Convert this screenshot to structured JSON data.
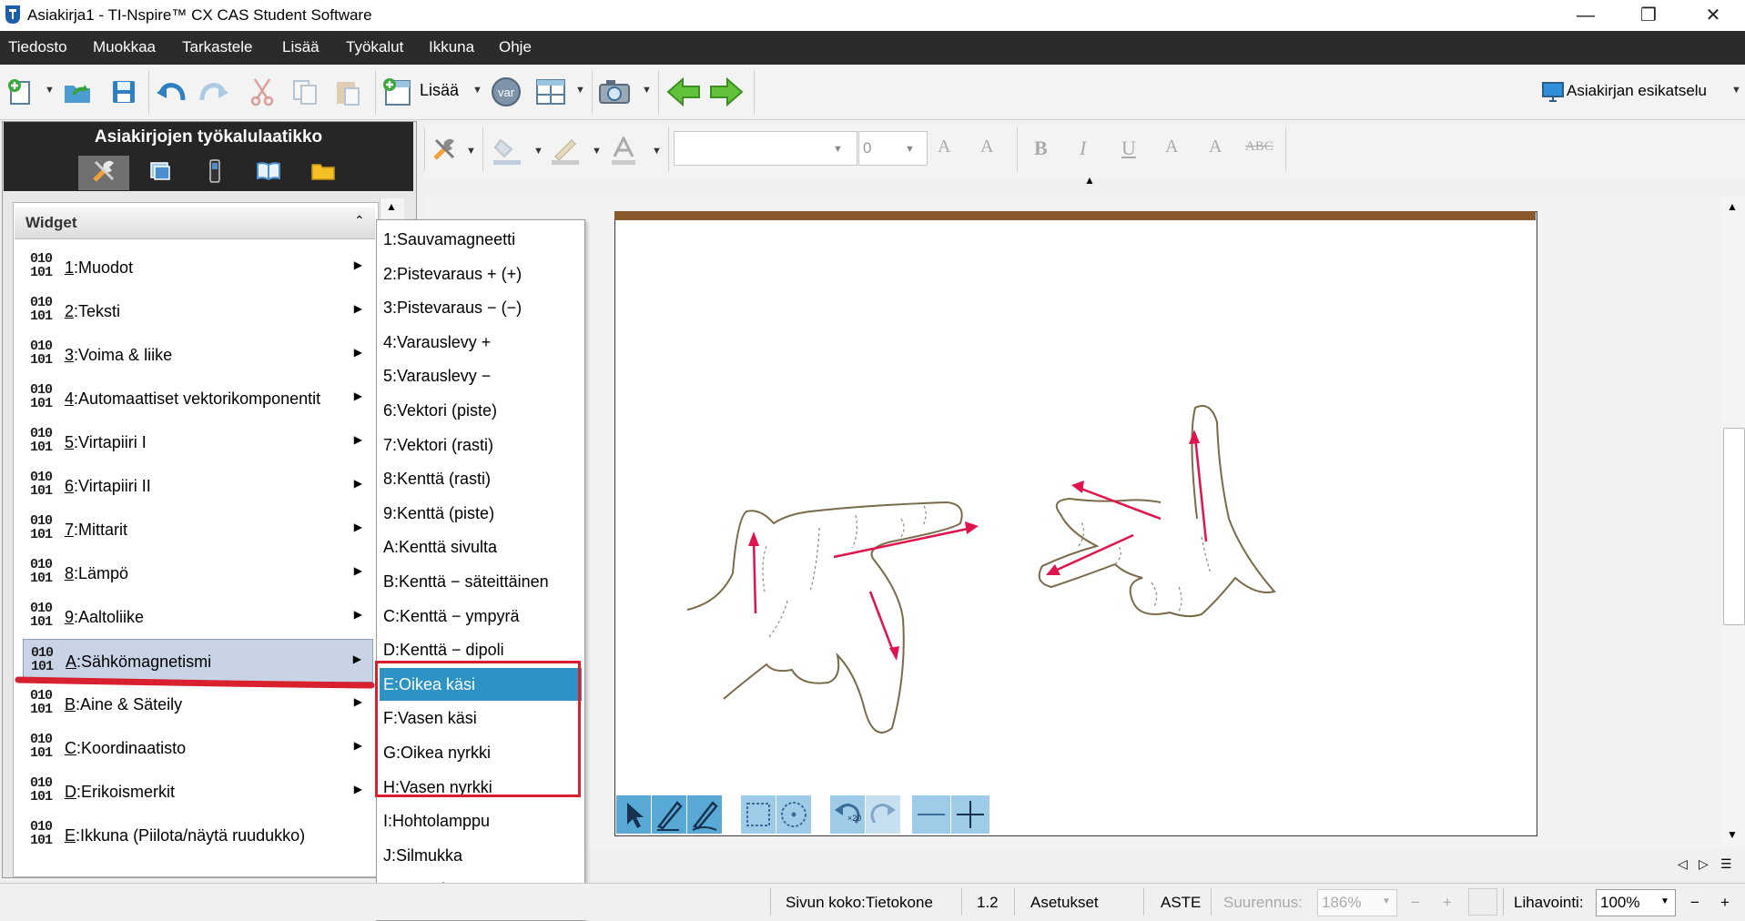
{
  "window": {
    "title": "Asiakirja1 - TI-Nspire™ CX CAS Student Software",
    "minimize": "—",
    "restore": "❐",
    "close": "✕"
  },
  "menu": [
    "Tiedosto",
    "Muokkaa",
    "Tarkastele",
    "Lisää",
    "Työkalut",
    "Ikkuna",
    "Ohje"
  ],
  "toolbar": {
    "insert_label": "Lisää",
    "var_label": "var",
    "preview_label": "Asiakirjan esikatselu"
  },
  "format_toolbar": {
    "font_size_value": "0",
    "bold": "B",
    "italic": "I",
    "underline": "U",
    "superscript": "A",
    "subscript": "A",
    "strike": "ABC",
    "grow": "A",
    "shrink": "A"
  },
  "toolbox": {
    "title": "Asiakirjojen työkalulaatikko",
    "panel_title": "Widget",
    "binary_top": "010",
    "binary_bottom": "101",
    "items": [
      {
        "key": "1",
        "label": "Muodot"
      },
      {
        "key": "2",
        "label": "Teksti"
      },
      {
        "key": "3",
        "label": "Voima & liike"
      },
      {
        "key": "4",
        "label": "Automaattiset vektorikomponentit"
      },
      {
        "key": "5",
        "label": "Virtapiiri I"
      },
      {
        "key": "6",
        "label": "Virtapiiri II"
      },
      {
        "key": "7",
        "label": "Mittarit"
      },
      {
        "key": "8",
        "label": "Lämpö"
      },
      {
        "key": "9",
        "label": "Aaltoliike"
      },
      {
        "key": "A",
        "label": "Sähkömagnetismi"
      },
      {
        "key": "B",
        "label": "Aine & Säteily"
      },
      {
        "key": "C",
        "label": "Koordinaatisto"
      },
      {
        "key": "D",
        "label": "Erikoismerkit"
      },
      {
        "key": "E",
        "label": "Ikkuna (Piilota/näytä ruudukko)"
      }
    ]
  },
  "submenu": [
    "1:Sauvamagneetti",
    "2:Pistevaraus + (+)",
    "3:Pistevaraus − (−)",
    "4:Varauslevy +",
    "5:Varauslevy −",
    "6:Vektori (piste)",
    "7:Vektori (rasti)",
    "8:Kenttä (rasti)",
    "9:Kenttä (piste)",
    "A:Kenttä sivulta",
    "B:Kenttä − säteittäinen",
    "C:Kenttä − ympyrä",
    "D:Kenttä − dipoli",
    "E:Oikea käsi",
    "F:Vasen käsi",
    "G:Oikea nyrkki",
    "H:Vasen nyrkki",
    "I:Hohtolamppu",
    "J:Silmukka",
    "K:Käämi"
  ],
  "status": {
    "page_size": "Sivun koko:Tietokone",
    "page_num": "1.2",
    "settings": "Asetukset",
    "angle": "ASTE",
    "zoom_label": "Suurennus:",
    "zoom_value": "186%",
    "pan_label": "Lihavointi:",
    "pan_value": "100%"
  },
  "colors": {
    "menubar": "#2b2b2b",
    "highlight": "#2c93c4",
    "annotation_red": "#d8202f",
    "page_border_top": "#8a5a2e",
    "vector_red": "#e0144c"
  }
}
